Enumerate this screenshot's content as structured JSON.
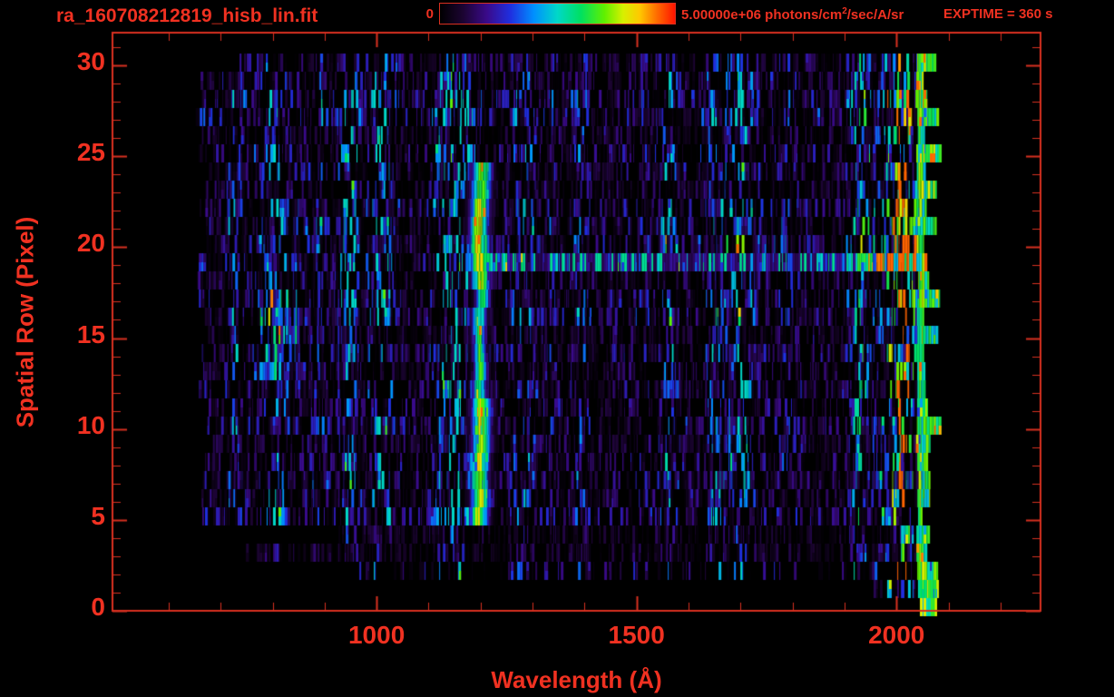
{
  "header": {
    "title": "ra_160708212819_hisb_lin.fit",
    "colorbar": {
      "min_label": "0",
      "max_label_prefix": "5.00000e+06 photons/cm",
      "max_label_sup": "2",
      "max_label_suffix": "/sec/A/sr"
    },
    "exptime_label": "EXPTIME = 360 s"
  },
  "colors": {
    "accent": "#f03121",
    "frame": "#d93020",
    "background": "#000000"
  },
  "chart_data": {
    "type": "heatmap",
    "title": "ra_160708212819_hisb_lin.fit",
    "xlabel": "Wavelength (Å)",
    "ylabel": "Spatial Row (Pixel)",
    "xlim": [
      492,
      2277
    ],
    "ylim": [
      0,
      31.8
    ],
    "x_major_ticks": [
      1000,
      1500,
      2000
    ],
    "x_minor_step": 100,
    "y_major_ticks": [
      0,
      5,
      10,
      15,
      20,
      25,
      30
    ],
    "y_minor_step": 1,
    "colorbar": {
      "min": 0,
      "max": 5000000,
      "units": "photons/cm^2/sec/A/sr",
      "palette": [
        [
          0,
          "#000000"
        ],
        [
          0.1,
          "#1c0433"
        ],
        [
          0.2,
          "#3a0a8a"
        ],
        [
          0.3,
          "#1f2fe0"
        ],
        [
          0.4,
          "#0090ff"
        ],
        [
          0.5,
          "#00d8c8"
        ],
        [
          0.6,
          "#00e060"
        ],
        [
          0.7,
          "#60f000"
        ],
        [
          0.78,
          "#d8f000"
        ],
        [
          0.85,
          "#ffc800"
        ],
        [
          0.92,
          "#ff7000"
        ],
        [
          1,
          "#ff1400"
        ]
      ]
    },
    "exptime_s": 360,
    "data_extent": {
      "wavelength_range": [
        650,
        2083
      ],
      "row_range": [
        0,
        30
      ]
    },
    "features": [
      {
        "name": "emission-line",
        "wavelength": 1200,
        "sigma_A": 12,
        "rows": [
          5,
          24
        ],
        "peak_frac": 0.75,
        "note": "bright green vertical emission line near Lyman-alpha"
      },
      {
        "name": "bright-row-band",
        "row": 19,
        "wavelength_range": [
          1208,
          2083
        ],
        "boost": 2.2
      },
      {
        "name": "right-edge-brightening",
        "wavelength_range": [
          1915,
          2083
        ],
        "boost_max": 3.2,
        "note": "dense cyan/green strands, yellow-orange at extreme edge"
      },
      {
        "name": "cyan-patch",
        "wavelength_range": [
          775,
          852
        ],
        "rows": [
          13,
          17
        ],
        "boost": 1.8
      },
      {
        "name": "sparse-bottom-rows",
        "rows": [
          0,
          2
        ],
        "note": "only short segments near 2000-2080 A"
      }
    ],
    "noise": {
      "seed": 20160708,
      "miss_fraction": 0.32,
      "base_max": 0.4
    }
  }
}
